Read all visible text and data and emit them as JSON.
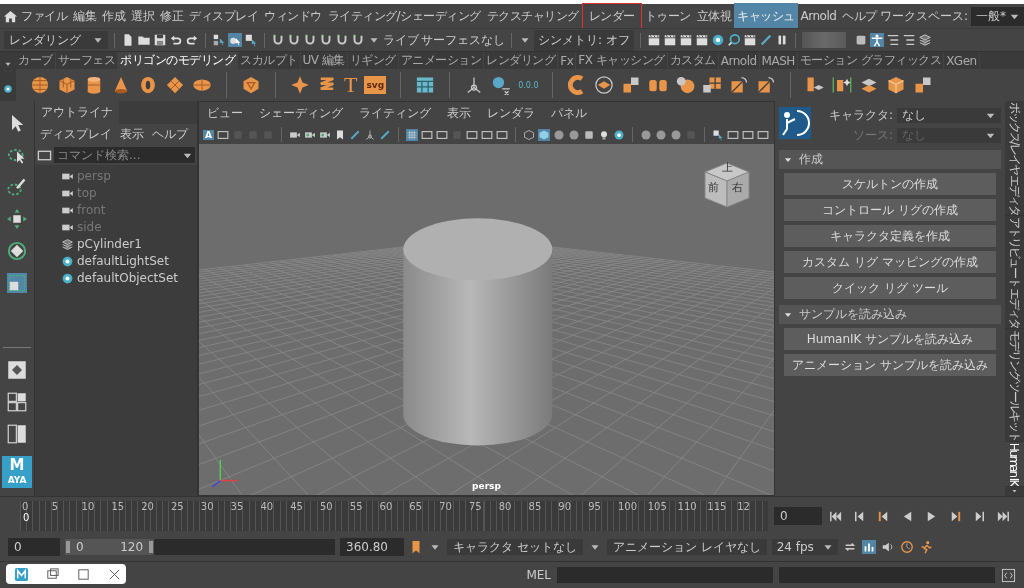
{
  "menu_bar": {
    "items": [
      {
        "label": "ファイル",
        "selected": false,
        "outlined": false
      },
      {
        "label": "編集",
        "selected": false,
        "outlined": false
      },
      {
        "label": "作成",
        "selected": false,
        "outlined": false
      },
      {
        "label": "選択",
        "selected": false,
        "outlined": false
      },
      {
        "label": "修正",
        "selected": false,
        "outlined": false
      },
      {
        "label": "ディスプレイ",
        "selected": false,
        "outlined": false
      },
      {
        "label": "ウィンドウ",
        "selected": false,
        "outlined": false
      },
      {
        "label": "ライティング/シェーディング",
        "selected": false,
        "outlined": false
      },
      {
        "label": "テクスチャリング",
        "selected": false,
        "outlined": false
      },
      {
        "label": "レンダー",
        "selected": false,
        "outlined": true
      },
      {
        "label": "トゥーン",
        "selected": false,
        "outlined": false
      },
      {
        "label": "立体視",
        "selected": false,
        "outlined": false
      },
      {
        "label": "キャッシュ",
        "selected": true,
        "outlined": false
      },
      {
        "label": "Arnold",
        "selected": false,
        "outlined": false
      },
      {
        "label": "ヘルプ",
        "selected": false,
        "outlined": false
      }
    ],
    "workspace_label": "ワークスペース:",
    "workspace_value": "一般*"
  },
  "status_line": {
    "menu_set": "レンダリング",
    "live_label": "ライブ",
    "live_value": "サーフェスなし",
    "symmetry": "シンメトリ: オフ"
  },
  "shelf": {
    "tabs": [
      {
        "label": "カーブ",
        "selected": false
      },
      {
        "label": "サーフェス",
        "selected": false
      },
      {
        "label": "ポリゴンのモデリング",
        "selected": true
      },
      {
        "label": "スカルプト",
        "selected": false
      },
      {
        "label": "UV 編集",
        "selected": false
      },
      {
        "label": "リギング",
        "selected": false
      },
      {
        "label": "アニメーション",
        "selected": false
      },
      {
        "label": "レンダリング",
        "selected": false
      },
      {
        "label": "Fx",
        "selected": false
      },
      {
        "label": "FX キャッシング",
        "selected": false
      },
      {
        "label": "カスタム",
        "selected": false
      },
      {
        "label": "Arnold",
        "selected": false
      },
      {
        "label": "MASH",
        "selected": false
      },
      {
        "label": "モーション グラフィックス",
        "selected": false
      },
      {
        "label": "XGen",
        "selected": false
      }
    ],
    "text_tool": "T",
    "svg_tool": "svg",
    "pivot_reading": "0.0.0"
  },
  "toolbox": {
    "logo_letter": "M",
    "logo_caption": "AYA"
  },
  "outliner": {
    "title": "アウトライナ",
    "menus": [
      "ディスプレイ",
      "表示",
      "ヘルプ"
    ],
    "search_placeholder": "コマンド検索...",
    "items": [
      {
        "label": "persp",
        "kind": "camera",
        "dimmed": true
      },
      {
        "label": "top",
        "kind": "camera",
        "dimmed": true
      },
      {
        "label": "front",
        "kind": "camera",
        "dimmed": true
      },
      {
        "label": "side",
        "kind": "camera",
        "dimmed": true
      },
      {
        "label": "pCylinder1",
        "kind": "mesh",
        "dimmed": false
      },
      {
        "label": "defaultLightSet",
        "kind": "set",
        "dimmed": false
      },
      {
        "label": "defaultObjectSet",
        "kind": "set",
        "dimmed": false
      }
    ]
  },
  "viewport": {
    "menus": [
      "ビュー",
      "シェーディング",
      "ライティング",
      "表示",
      "レンダラ",
      "パネル"
    ],
    "toolbar_badge": "A",
    "view_cube": {
      "top": "上",
      "front": "前",
      "right": "右"
    },
    "camera_label": "persp"
  },
  "human_ik": {
    "character_label": "キャラクタ:",
    "character_value": "なし",
    "source_label": "ソース:",
    "source_value": "なし",
    "source_disabled": true,
    "sections": [
      {
        "title": "作成",
        "expanded": true,
        "buttons": [
          "スケルトンの作成",
          "コントロール リグの作成",
          "キャラクタ定義を作成",
          "カスタム リグ マッピングの作成",
          "クイック リグ ツール"
        ]
      },
      {
        "title": "サンプルを読み込み",
        "expanded": true,
        "buttons": [
          "HumanIK サンプルを読み込み",
          "アニメーション サンプルを読み込み"
        ]
      }
    ]
  },
  "side_tabs": [
    {
      "label": "ボックス/レイヤ エディタ",
      "selected": false
    },
    {
      "label": "アトリビュート エディタ",
      "selected": false
    },
    {
      "label": "モデリング ツールキット",
      "selected": false
    },
    {
      "label": "Human IK",
      "selected": true
    }
  ],
  "timeline": {
    "ticks": [
      "0",
      "5",
      "10",
      "15",
      "20",
      "25",
      "30",
      "35",
      "40",
      "45",
      "50",
      "55",
      "60",
      "65",
      "70",
      "75",
      "80",
      "85",
      "90",
      "95",
      "100",
      "105",
      "110",
      "115",
      "12"
    ],
    "current_frame": "0",
    "frame_field": "0"
  },
  "range": {
    "level": 0.33,
    "start": "0",
    "range_start": "0",
    "range_end": "120",
    "end": "360.80",
    "character_set": "キャラクタ セットなし",
    "anim_layer": "アニメーション レイヤなし",
    "fps": "24 fps"
  },
  "command_line": {
    "language": "MEL"
  }
}
